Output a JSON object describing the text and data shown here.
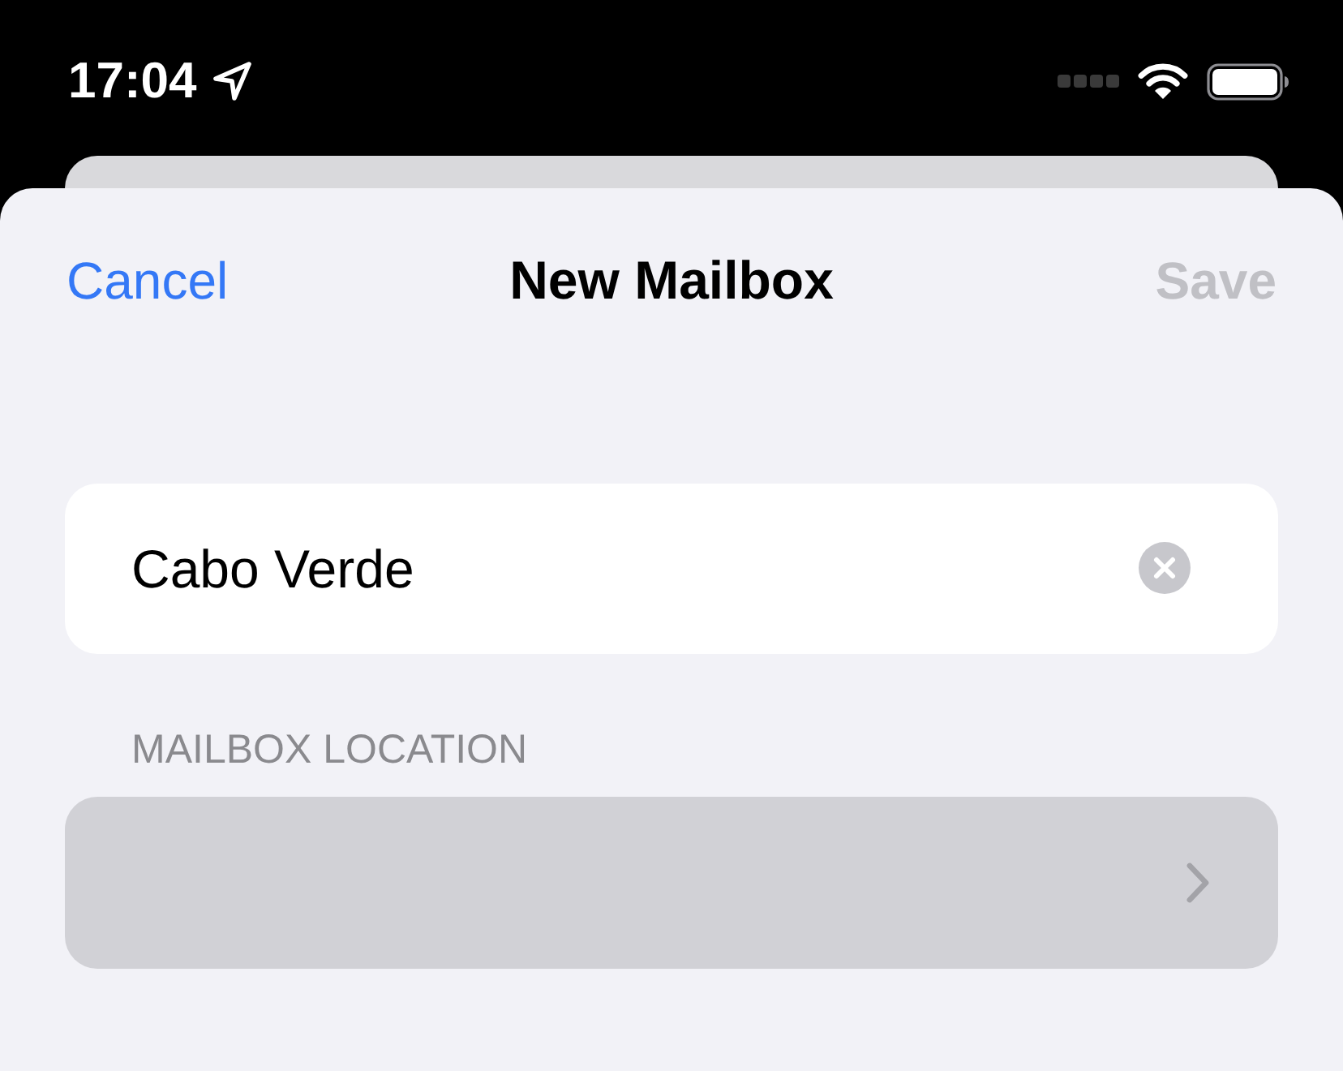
{
  "status_bar": {
    "time": "17:04"
  },
  "nav": {
    "cancel": "Cancel",
    "title": "New Mailbox",
    "save": {
      "label": "Save",
      "disabled": true
    }
  },
  "name_field": {
    "value": "Cabo Verde"
  },
  "location_section": {
    "header": "MAILBOX LOCATION",
    "row": {
      "highlighted": true
    }
  }
}
